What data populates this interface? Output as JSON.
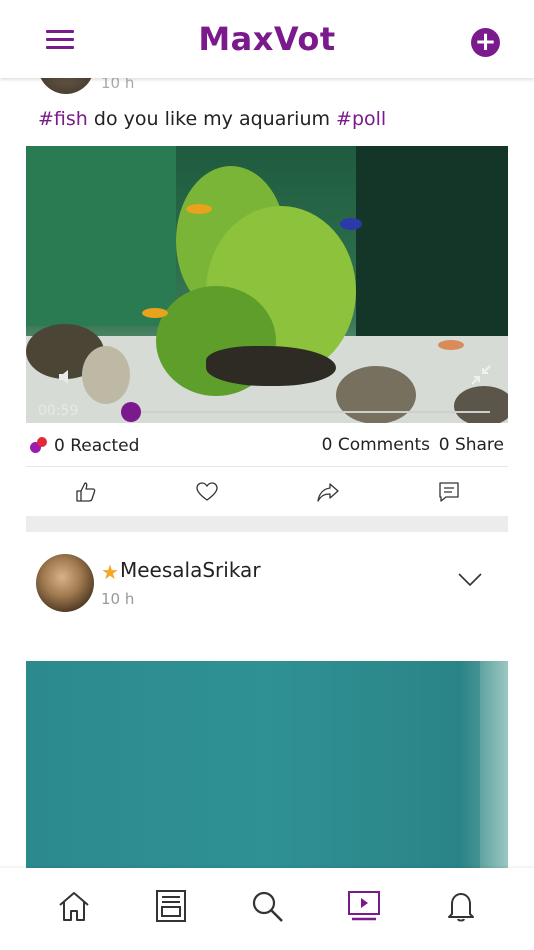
{
  "header": {
    "title": "MaxVot",
    "menu_icon": "hamburger-menu-icon",
    "add_icon": "plus-circle-icon",
    "accent_color": "#7b1a8c"
  },
  "post1": {
    "time": "10 h",
    "caption": {
      "tag1": "#fish",
      "text": "do you like my aquarium",
      "tag2": "#poll"
    },
    "video": {
      "current_time": "00:59",
      "progress": 0.06,
      "volume_icon": "speaker-icon",
      "expand_icon": "collapse-arrows-icon"
    },
    "stats": {
      "reacted": "0 Reacted",
      "comments": "0 Comments",
      "shares": "0 Share"
    },
    "actions": [
      "thumbs-up-icon",
      "heart-icon",
      "share-arrow-icon",
      "comment-icon"
    ]
  },
  "post2": {
    "username": "MeesalaSrikar",
    "time": "10 h",
    "badge_icon": "star-icon",
    "more_icon": "chevron-down-icon"
  },
  "bottom_nav": {
    "items": [
      "home-icon",
      "feed-icon",
      "search-icon",
      "video-icon",
      "bell-icon"
    ],
    "active": "video-icon"
  }
}
